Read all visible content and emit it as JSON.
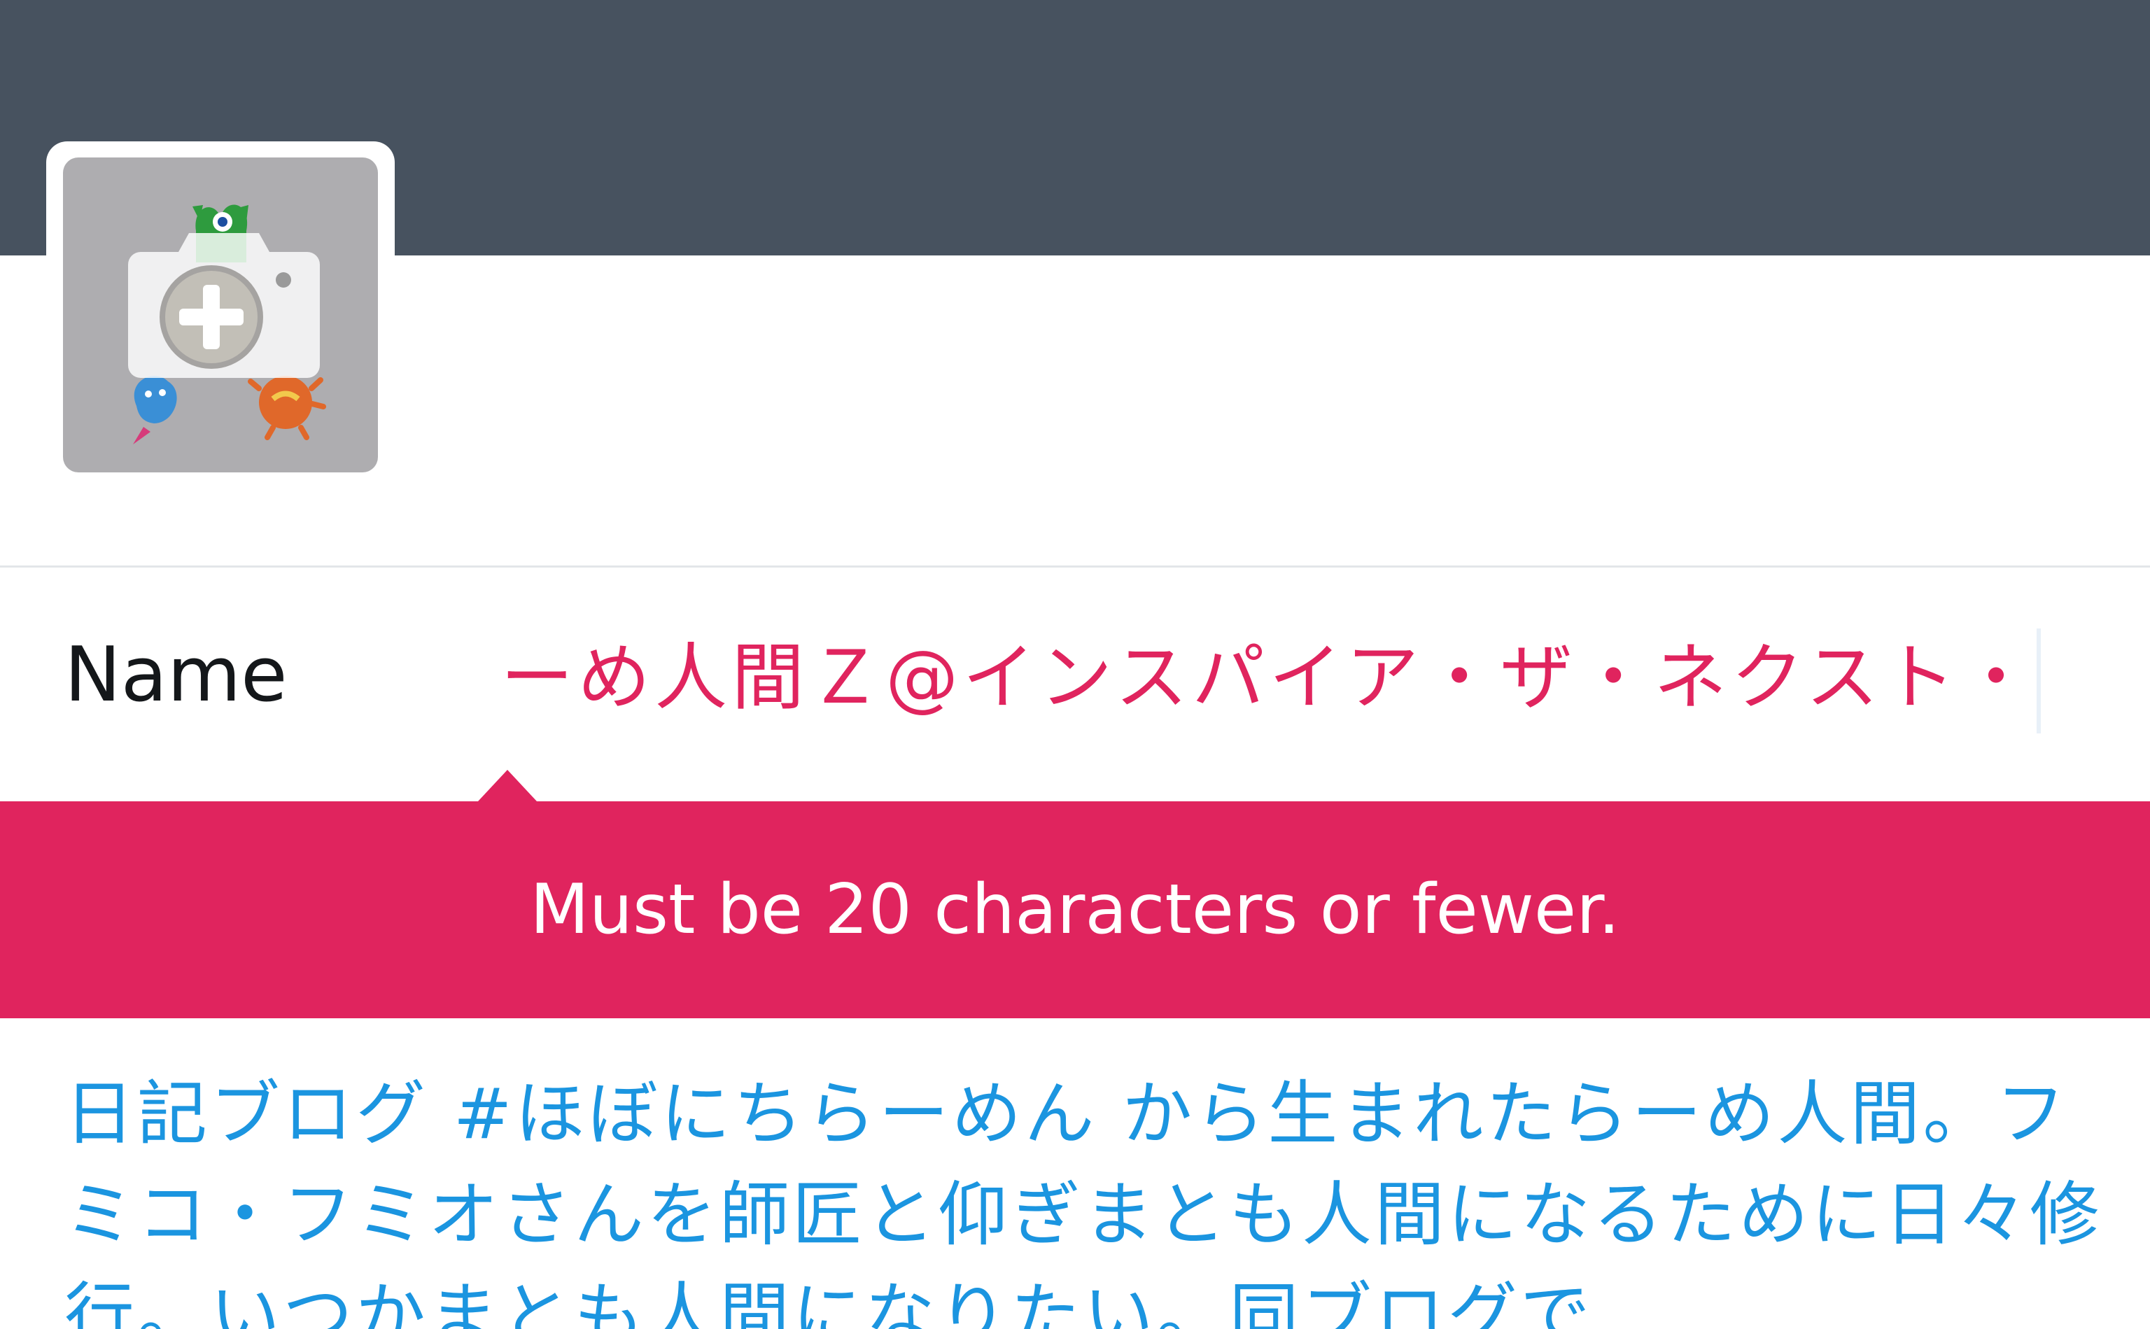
{
  "header": {
    "banner_color": "#47525f"
  },
  "avatar": {
    "overlay_icon": "camera-plus-icon"
  },
  "name_field": {
    "label": "Name",
    "value": "ーめ人間Ｚ@インスパイア・ザ・ネクスト・"
  },
  "error": {
    "message": "Must be 20 characters or fewer.",
    "color": "#e0245e"
  },
  "bio": {
    "text": "日記ブログ #ほぼにちらーめん から生まれたらーめ人間。フミコ・フミオさんを師匠と仰ぎまとも人間になるために日々修行。いつかまとも人間になりたい。同ブログで",
    "color": "#1b95e0"
  }
}
